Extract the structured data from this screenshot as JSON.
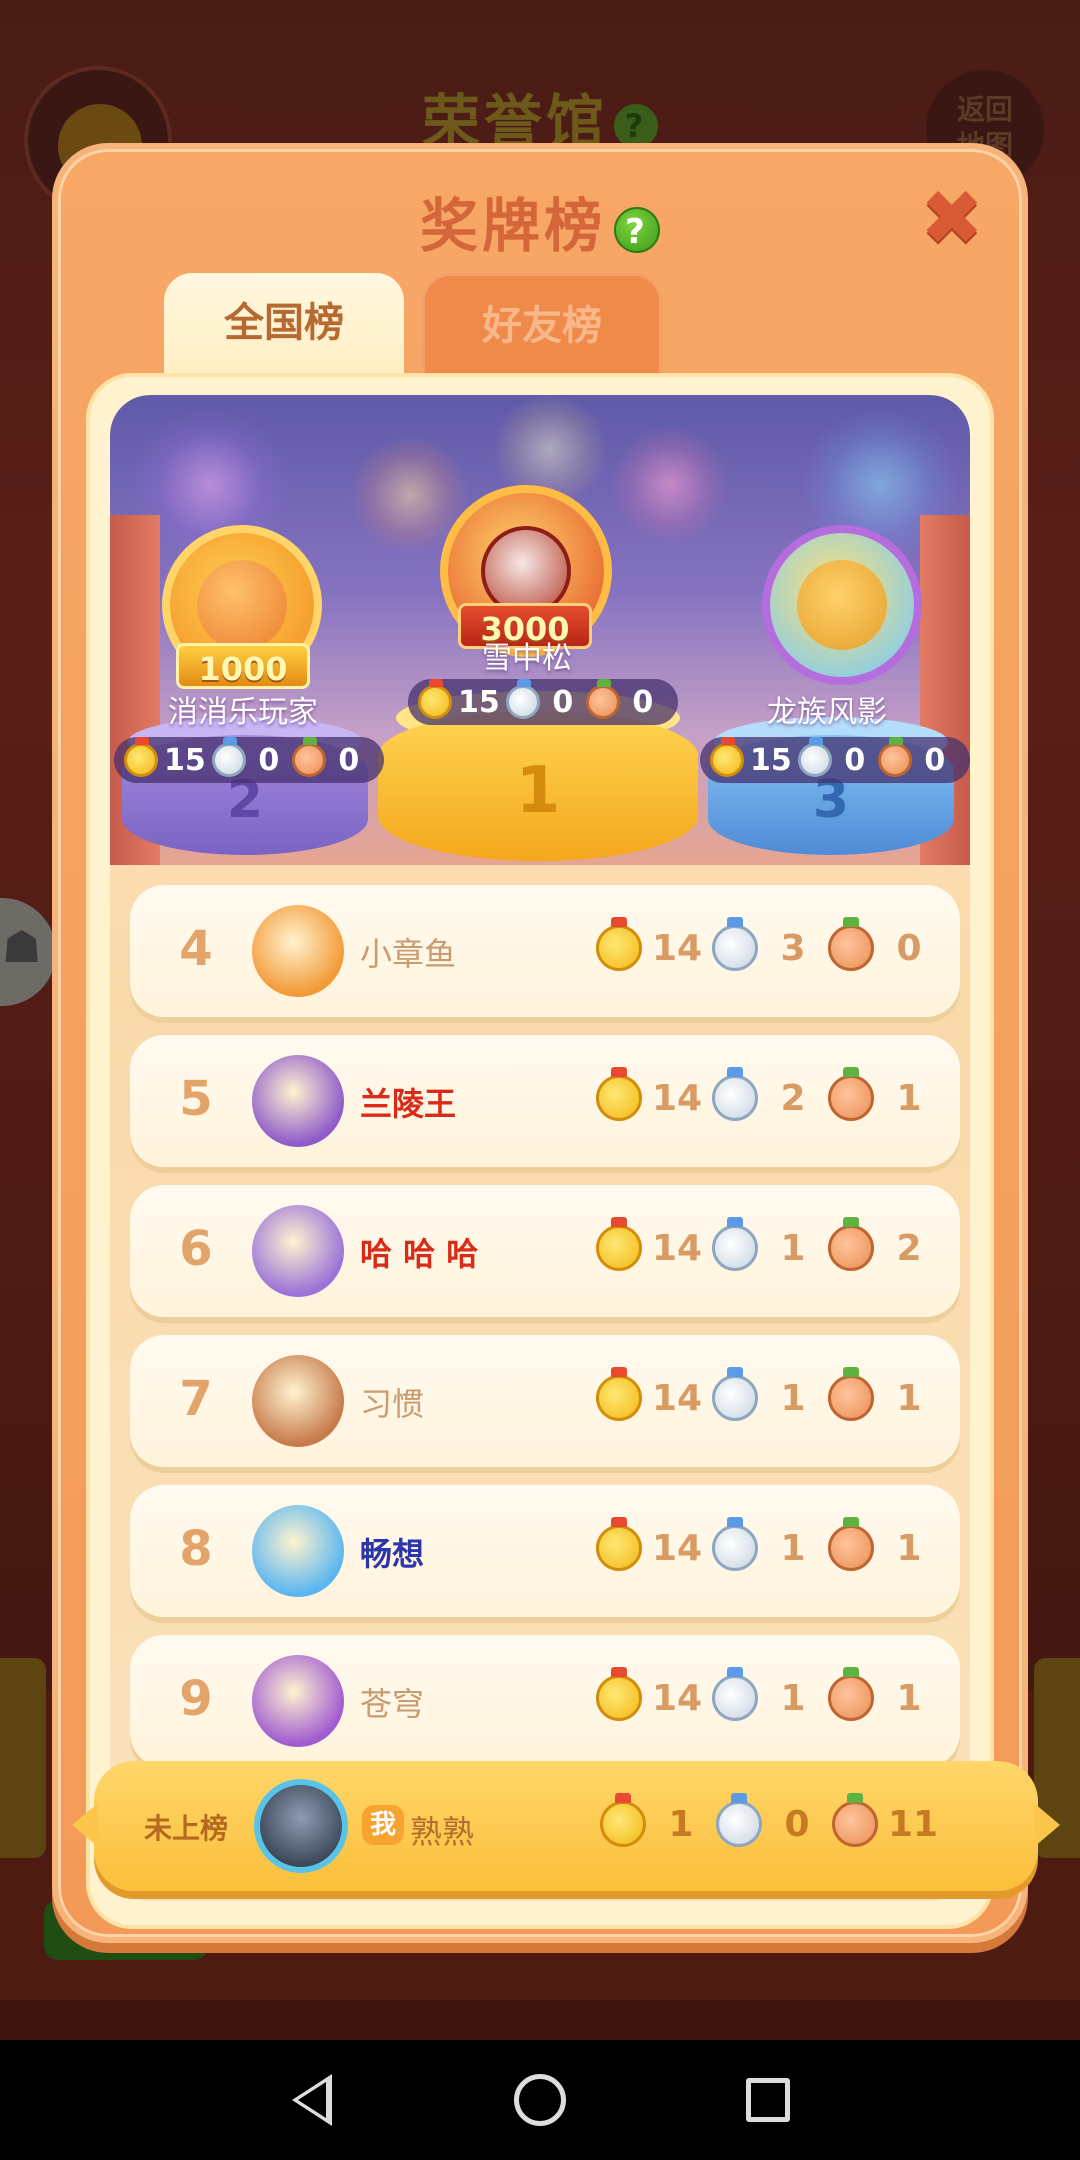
{
  "background": {
    "title": "荣誉馆",
    "return_button": "返回\n地图"
  },
  "dialog": {
    "title": "奖牌榜",
    "tabs": [
      {
        "label": "全国榜",
        "selected": true
      },
      {
        "label": "好友榜",
        "selected": false
      }
    ]
  },
  "podium": [
    {
      "rank": "1",
      "name": "雪中松",
      "score_badge": "3000",
      "gold": "15",
      "silver": "0",
      "bronze": "0"
    },
    {
      "rank": "2",
      "name": "消消乐玩家",
      "score_badge": "1000",
      "gold": "15",
      "silver": "0",
      "bronze": "0"
    },
    {
      "rank": "3",
      "name": "龙族风影",
      "score_badge": "",
      "gold": "15",
      "silver": "0",
      "bronze": "0"
    }
  ],
  "ranking": [
    {
      "rank": "4",
      "name": "小章鱼",
      "gold": "14",
      "silver": "3",
      "bronze": "0",
      "name_style": "normal",
      "avatar_color": "#f29a36"
    },
    {
      "rank": "5",
      "name": "兰陵王",
      "gold": "14",
      "silver": "2",
      "bronze": "1",
      "name_style": "red",
      "avatar_color": "#8e5bc9"
    },
    {
      "rank": "6",
      "name": "哈 哈 哈",
      "gold": "14",
      "silver": "1",
      "bronze": "2",
      "name_style": "red",
      "avatar_color": "#9a72d8"
    },
    {
      "rank": "7",
      "name": "习惯",
      "gold": "14",
      "silver": "1",
      "bronze": "1",
      "name_style": "normal",
      "avatar_color": "#c77a4a"
    },
    {
      "rank": "8",
      "name": "畅想",
      "gold": "14",
      "silver": "1",
      "bronze": "1",
      "name_style": "blue",
      "avatar_color": "#5ab6f0"
    },
    {
      "rank": "9",
      "name": "苍穹",
      "gold": "14",
      "silver": "1",
      "bronze": "1",
      "name_style": "normal",
      "avatar_color": "#a05bd0"
    }
  ],
  "self": {
    "rank_label": "未上榜",
    "tag": "我",
    "name": "熟熟",
    "gold": "1",
    "silver": "0",
    "bronze": "11"
  },
  "icons": {
    "help": "question-icon",
    "close": "close-icon",
    "medals": [
      "gold-medal-icon",
      "silver-medal-icon",
      "bronze-medal-icon"
    ]
  },
  "colors": {
    "dialog_bg": "#f39a58",
    "title": "#d4663a",
    "red_name": "#d92b17",
    "blue_name": "#2d36a8"
  }
}
